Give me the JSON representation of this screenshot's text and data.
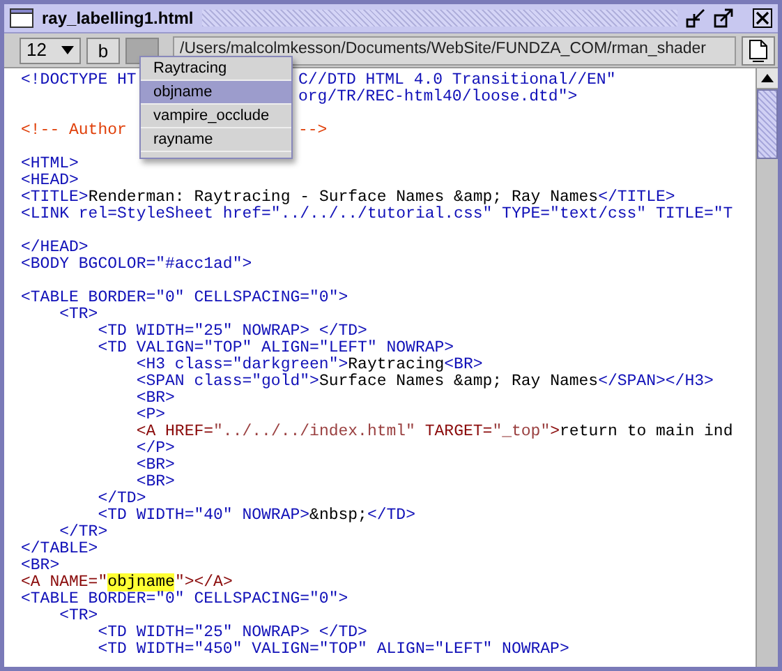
{
  "window": {
    "title": "ray_labelling1.html"
  },
  "toolbar": {
    "font_size": "12",
    "bold_label": "b",
    "menu_button_pressed": true,
    "path": "/Users/malcolmkesson/Documents/WebSite/FUNDZA_COM/rman_shader"
  },
  "popup_menu": {
    "items": [
      {
        "label": "Raytracing",
        "selected": false
      },
      {
        "label": "objname",
        "selected": true
      },
      {
        "label": "vampire_occlude",
        "selected": false
      },
      {
        "label": "rayname",
        "selected": false
      }
    ]
  },
  "editor": {
    "lines": [
      {
        "kind": "split",
        "before": [
          {
            "kind": "tag",
            "text": "<!DOCTYPE HT"
          }
        ],
        "after": [
          {
            "kind": "tag",
            "text": "C//DTD HTML 4.0 Transitional//EN\""
          }
        ]
      },
      {
        "kind": "split",
        "after": [
          {
            "kind": "tag",
            "text": "org/TR/REC-html40/loose.dtd\">"
          }
        ]
      },
      {
        "kind": "blank"
      },
      {
        "kind": "split",
        "before": [
          {
            "kind": "comment",
            "text": "<!-- Author"
          }
        ],
        "after": [
          {
            "kind": "comment",
            "text": "-->"
          }
        ]
      },
      {
        "kind": "blank"
      },
      {
        "kind": "code",
        "segments": [
          {
            "kind": "tag",
            "text": "<HTML>"
          }
        ]
      },
      {
        "kind": "code",
        "segments": [
          {
            "kind": "tag",
            "text": "<HEAD>"
          }
        ]
      },
      {
        "kind": "code",
        "segments": [
          {
            "kind": "tag",
            "text": "<TITLE>"
          },
          {
            "kind": "text",
            "text": "Renderman: Raytracing - Surface Names &amp; Ray Names"
          },
          {
            "kind": "tag",
            "text": "</TITLE>"
          }
        ]
      },
      {
        "kind": "code",
        "segments": [
          {
            "kind": "tag",
            "text": "<LINK rel=StyleSheet href=\"../../../tutorial.css\" TYPE=\"text/css\" TITLE=\"T"
          }
        ]
      },
      {
        "kind": "blank"
      },
      {
        "kind": "code",
        "segments": [
          {
            "kind": "tag",
            "text": "</HEAD>"
          }
        ]
      },
      {
        "kind": "code",
        "segments": [
          {
            "kind": "tag",
            "text": "<BODY BGCOLOR=\"#acc1ad\">"
          }
        ]
      },
      {
        "kind": "blank"
      },
      {
        "kind": "code",
        "segments": [
          {
            "kind": "tag",
            "text": "<TABLE BORDER=\"0\" CELLSPACING=\"0\">"
          }
        ]
      },
      {
        "kind": "code",
        "segments": [
          {
            "kind": "tag",
            "text": "    <TR>"
          }
        ]
      },
      {
        "kind": "code",
        "segments": [
          {
            "kind": "tag",
            "text": "        <TD WIDTH=\"25\" NOWRAP> </TD>"
          }
        ]
      },
      {
        "kind": "code",
        "segments": [
          {
            "kind": "tag",
            "text": "        <TD VALIGN=\"TOP\" ALIGN=\"LEFT\" NOWRAP>"
          }
        ]
      },
      {
        "kind": "code",
        "segments": [
          {
            "kind": "tag",
            "text": "            <H3 class=\"darkgreen\">"
          },
          {
            "kind": "text",
            "text": "Raytracing"
          },
          {
            "kind": "tag",
            "text": "<BR>"
          }
        ]
      },
      {
        "kind": "code",
        "segments": [
          {
            "kind": "tag",
            "text": "            <SPAN class=\"gold\">"
          },
          {
            "kind": "text",
            "text": "Surface Names &amp; Ray Names"
          },
          {
            "kind": "tag",
            "text": "</SPAN></H3>"
          }
        ]
      },
      {
        "kind": "code",
        "segments": [
          {
            "kind": "tag",
            "text": "            <BR>"
          }
        ]
      },
      {
        "kind": "code",
        "segments": [
          {
            "kind": "tag",
            "text": "            <P>"
          }
        ]
      },
      {
        "kind": "code",
        "segments": [
          {
            "kind": "anchor",
            "text": "            <A HREF="
          },
          {
            "kind": "anchor_value",
            "text": "\"../../../index.html\""
          },
          {
            "kind": "anchor",
            "text": " TARGET="
          },
          {
            "kind": "anchor_value",
            "text": "\"_top\""
          },
          {
            "kind": "anchor",
            "text": ">"
          },
          {
            "kind": "text",
            "text": "return to main ind"
          }
        ]
      },
      {
        "kind": "code",
        "segments": [
          {
            "kind": "tag",
            "text": "            </P>"
          }
        ]
      },
      {
        "kind": "code",
        "segments": [
          {
            "kind": "tag",
            "text": "            <BR>"
          }
        ]
      },
      {
        "kind": "code",
        "segments": [
          {
            "kind": "tag",
            "text": "            <BR>"
          }
        ]
      },
      {
        "kind": "code",
        "segments": [
          {
            "kind": "tag",
            "text": "        </TD>"
          }
        ]
      },
      {
        "kind": "code",
        "segments": [
          {
            "kind": "tag",
            "text": "        <TD WIDTH=\"40\" NOWRAP>"
          },
          {
            "kind": "text",
            "text": "&nbsp;"
          },
          {
            "kind": "tag",
            "text": "</TD>"
          }
        ]
      },
      {
        "kind": "code",
        "segments": [
          {
            "kind": "tag",
            "text": "    </TR>"
          }
        ]
      },
      {
        "kind": "code",
        "segments": [
          {
            "kind": "tag",
            "text": "</TABLE>"
          }
        ]
      },
      {
        "kind": "code",
        "segments": [
          {
            "kind": "tag",
            "text": "<BR>"
          }
        ]
      },
      {
        "kind": "code",
        "segments": [
          {
            "kind": "anchor",
            "text": "<A NAME=\""
          },
          {
            "kind": "match",
            "text": "objname"
          },
          {
            "kind": "anchor",
            "text": "\"></A>"
          }
        ]
      },
      {
        "kind": "code",
        "segments": [
          {
            "kind": "tag",
            "text": "<TABLE BORDER=\"0\" CELLSPACING=\"0\">"
          }
        ]
      },
      {
        "kind": "code",
        "segments": [
          {
            "kind": "tag",
            "text": "    <TR>"
          }
        ]
      },
      {
        "kind": "code",
        "segments": [
          {
            "kind": "tag",
            "text": "        <TD WIDTH=\"25\" NOWRAP> </TD>"
          }
        ]
      },
      {
        "kind": "code",
        "segments": [
          {
            "kind": "tag",
            "text": "        <TD WIDTH=\"450\" VALIGN=\"TOP\" ALIGN=\"LEFT\" NOWRAP>"
          }
        ]
      }
    ]
  }
}
